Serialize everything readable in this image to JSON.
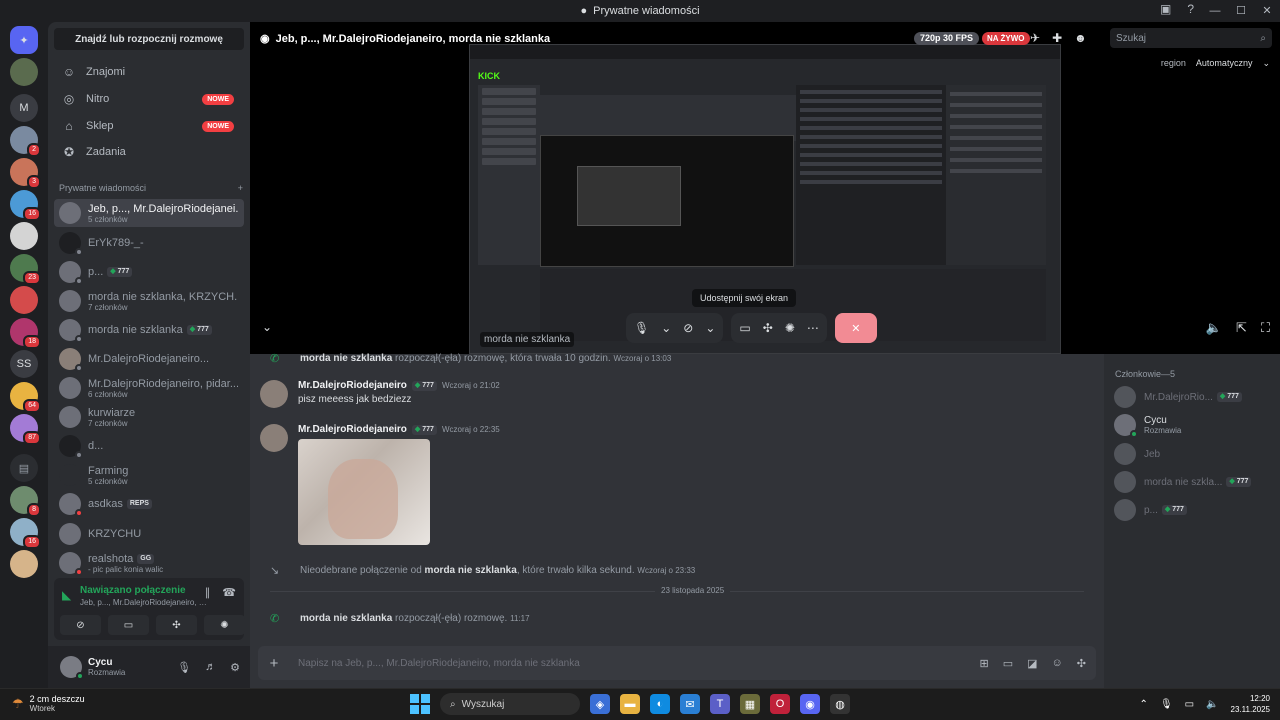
{
  "window": {
    "title": "Prywatne wiadomości"
  },
  "rail": {
    "badges": [
      "2",
      "3",
      "16",
      "23",
      "18",
      "64",
      "87",
      "8",
      "16"
    ],
    "letters": [
      "M",
      "SS"
    ]
  },
  "sidebar": {
    "find_label": "Znajdź lub rozpocznij rozmowę",
    "nav": [
      {
        "label": "Znajomi",
        "icon": "friends-icon"
      },
      {
        "label": "Nitro",
        "icon": "nitro-icon",
        "badge": "NOWE"
      },
      {
        "label": "Sklep",
        "icon": "shop-icon",
        "badge": "NOWE"
      },
      {
        "label": "Zadania",
        "icon": "quests-icon"
      }
    ],
    "dm_header": "Prywatne wiadomości",
    "dm_add": "+",
    "dms": [
      {
        "name": "Jeb, p..., Mr.DalejroRiodejanei...",
        "sub": "5 członków",
        "tag": ""
      },
      {
        "name": "ErYk789-_-",
        "sub": "",
        "tag": ""
      },
      {
        "name": "p...",
        "sub": "",
        "tag": "777"
      },
      {
        "name": "morda nie szklanka, KRZYCH...",
        "sub": "7 członków",
        "tag": ""
      },
      {
        "name": "morda nie szklanka",
        "sub": "",
        "tag": "777"
      },
      {
        "name": "Mr.DalejroRiodejaneiro...",
        "sub": "",
        "tag": ""
      },
      {
        "name": "Mr.DalejroRiodejaneiro, pidar...",
        "sub": "6 członków",
        "tag": ""
      },
      {
        "name": "kurwiarze",
        "sub": "7 członków",
        "tag": ""
      },
      {
        "name": "d...",
        "sub": "",
        "tag": ""
      },
      {
        "name": "Farming",
        "sub": "5 członków",
        "tag": ""
      },
      {
        "name": "asdkas",
        "sub": "",
        "tag": "REPS"
      },
      {
        "name": "KRZYCHU",
        "sub": "",
        "tag": ""
      },
      {
        "name": "realshota",
        "sub": "- pic palic konia walic",
        "tag": "GG"
      }
    ]
  },
  "voice": {
    "status": "Nawiązano połączenie",
    "channel": "Jeb, p..., Mr.DalejroRiodejaneiro, morda ..."
  },
  "user": {
    "name": "Cycu",
    "status": "Rozmawia"
  },
  "call": {
    "title": "Jeb, p..., Mr.DalejroRiodejaneiro, morda nie szklanka",
    "quality": "720p 30 FPS",
    "live": "NA ŻYWO",
    "search_placeholder": "Szukaj",
    "region_label": "region",
    "region_value": "Automatyczny",
    "streamer": "morda nie szklanka",
    "tooltip": "Udostępnij swój ekran",
    "kick_logo": "KICK"
  },
  "chat": {
    "messages": [
      {
        "type": "system",
        "user": "morda nie szklanka",
        "text": "rozpoczął(-ęła) rozmowę, która trwała 10 godzin.",
        "time": "Wczoraj o 13:03"
      },
      {
        "type": "user",
        "user": "Mr.DalejroRiodejaneiro",
        "tag": "777",
        "time": "Wczoraj o 21:02",
        "text": "pisz meeess jak bedziezz"
      },
      {
        "type": "user",
        "user": "Mr.DalejroRiodejaneiro",
        "tag": "777",
        "time": "Wczoraj o 22:35",
        "text": ""
      },
      {
        "type": "system",
        "prefix": "Nieodebrane połączenie od",
        "user": "morda nie szklanka",
        "text": ", które trwało kilka sekund.",
        "time": "Wczoraj o 23:33"
      },
      {
        "type": "system",
        "user": "morda nie szklanka",
        "text": "rozpoczął(-ęła) rozmowę.",
        "time": "11:17"
      }
    ],
    "date_separator": "23 listopada 2025",
    "composer_placeholder": "Napisz na Jeb, p..., Mr.DalejroRiodejaneiro, morda nie szklanka"
  },
  "members": {
    "header": "Członkowie—5",
    "list": [
      {
        "name": "Mr.DalejroRio...",
        "tag": "777",
        "sub": ""
      },
      {
        "name": "Cycu",
        "tag": "",
        "sub": "Rozmawia"
      },
      {
        "name": "Jeb",
        "tag": "",
        "sub": ""
      },
      {
        "name": "morda nie szkla...",
        "tag": "777",
        "sub": ""
      },
      {
        "name": "p...",
        "tag": "777",
        "sub": ""
      }
    ]
  },
  "taskbar": {
    "weather_temp": "2 cm deszczu",
    "weather_day": "Wtorek",
    "search_label": "Wyszukaj",
    "time": "12:20",
    "date": "23.11.2025"
  },
  "colors": {
    "accent": "#5865f2",
    "online": "#23a55a",
    "danger": "#da373c",
    "hangup": "#f28b94"
  }
}
